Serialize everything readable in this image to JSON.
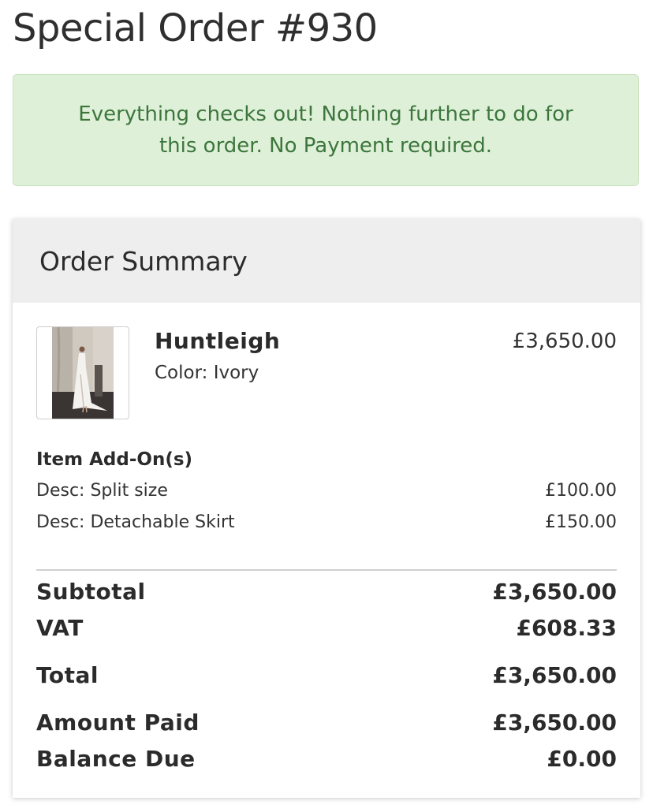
{
  "page": {
    "title": "Special Order #930"
  },
  "alert": {
    "message": "Everything checks out! Nothing further to do for this order. No Payment required.",
    "color": "#dff0d8"
  },
  "summary": {
    "title": "Order Summary",
    "item": {
      "name": "Huntleigh",
      "color_label": "Color: Ivory",
      "price": "£3,650.00",
      "image_icon": "dress-photo"
    },
    "addons": {
      "title": "Item Add-On(s)",
      "items": [
        {
          "desc": "Desc: Split size",
          "price": "£100.00"
        },
        {
          "desc": "Desc: Detachable Skirt",
          "price": "£150.00"
        }
      ]
    },
    "totals": [
      {
        "label": "Subtotal",
        "value": "£3,650.00"
      },
      {
        "label": "VAT",
        "value": "£608.33"
      },
      {
        "label": "Total",
        "value": "£3,650.00"
      },
      {
        "label": "Amount Paid",
        "value": "£3,650.00"
      },
      {
        "label": "Balance Due",
        "value": "£0.00"
      }
    ]
  }
}
